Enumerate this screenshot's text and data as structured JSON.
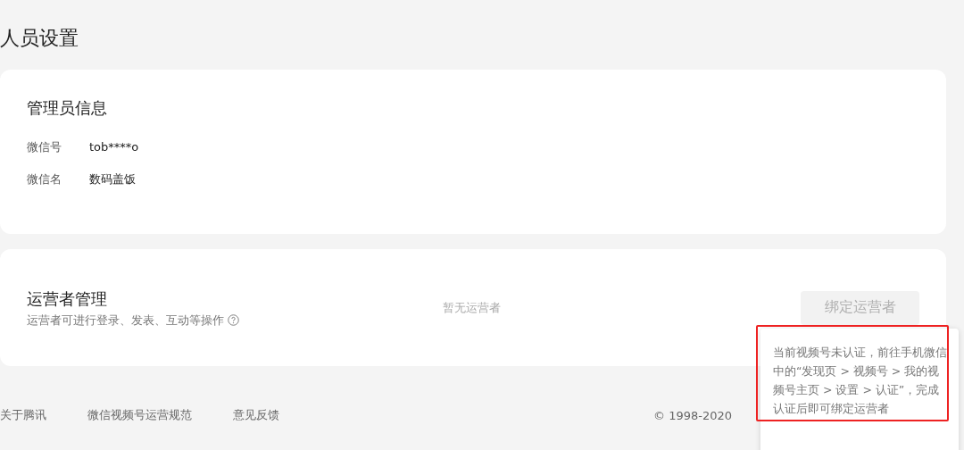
{
  "page_title": "人员设置",
  "admin_card": {
    "title": "管理员信息",
    "fields": [
      {
        "label": "微信号",
        "value": "tob****o"
      },
      {
        "label": "微信名",
        "value": "数码盖饭"
      }
    ]
  },
  "operator_card": {
    "title": "运营者管理",
    "description": "运营者可进行登录、发表、互动等操作",
    "empty_text": "暂无运营者",
    "bind_button": {
      "label": "绑定运营者",
      "disabled": true
    }
  },
  "tooltip": {
    "text": "当前视频号未认证，前往手机微信中的“发现页 > 视频号 > 我的视频号主页 > 设置 > 认证”，完成认证后即可绑定运营者",
    "highlighted": true
  },
  "footer": {
    "links": [
      "关于腾讯",
      "微信视频号运营规范",
      "意见反馈"
    ],
    "copyright": "© 1998-2020"
  }
}
